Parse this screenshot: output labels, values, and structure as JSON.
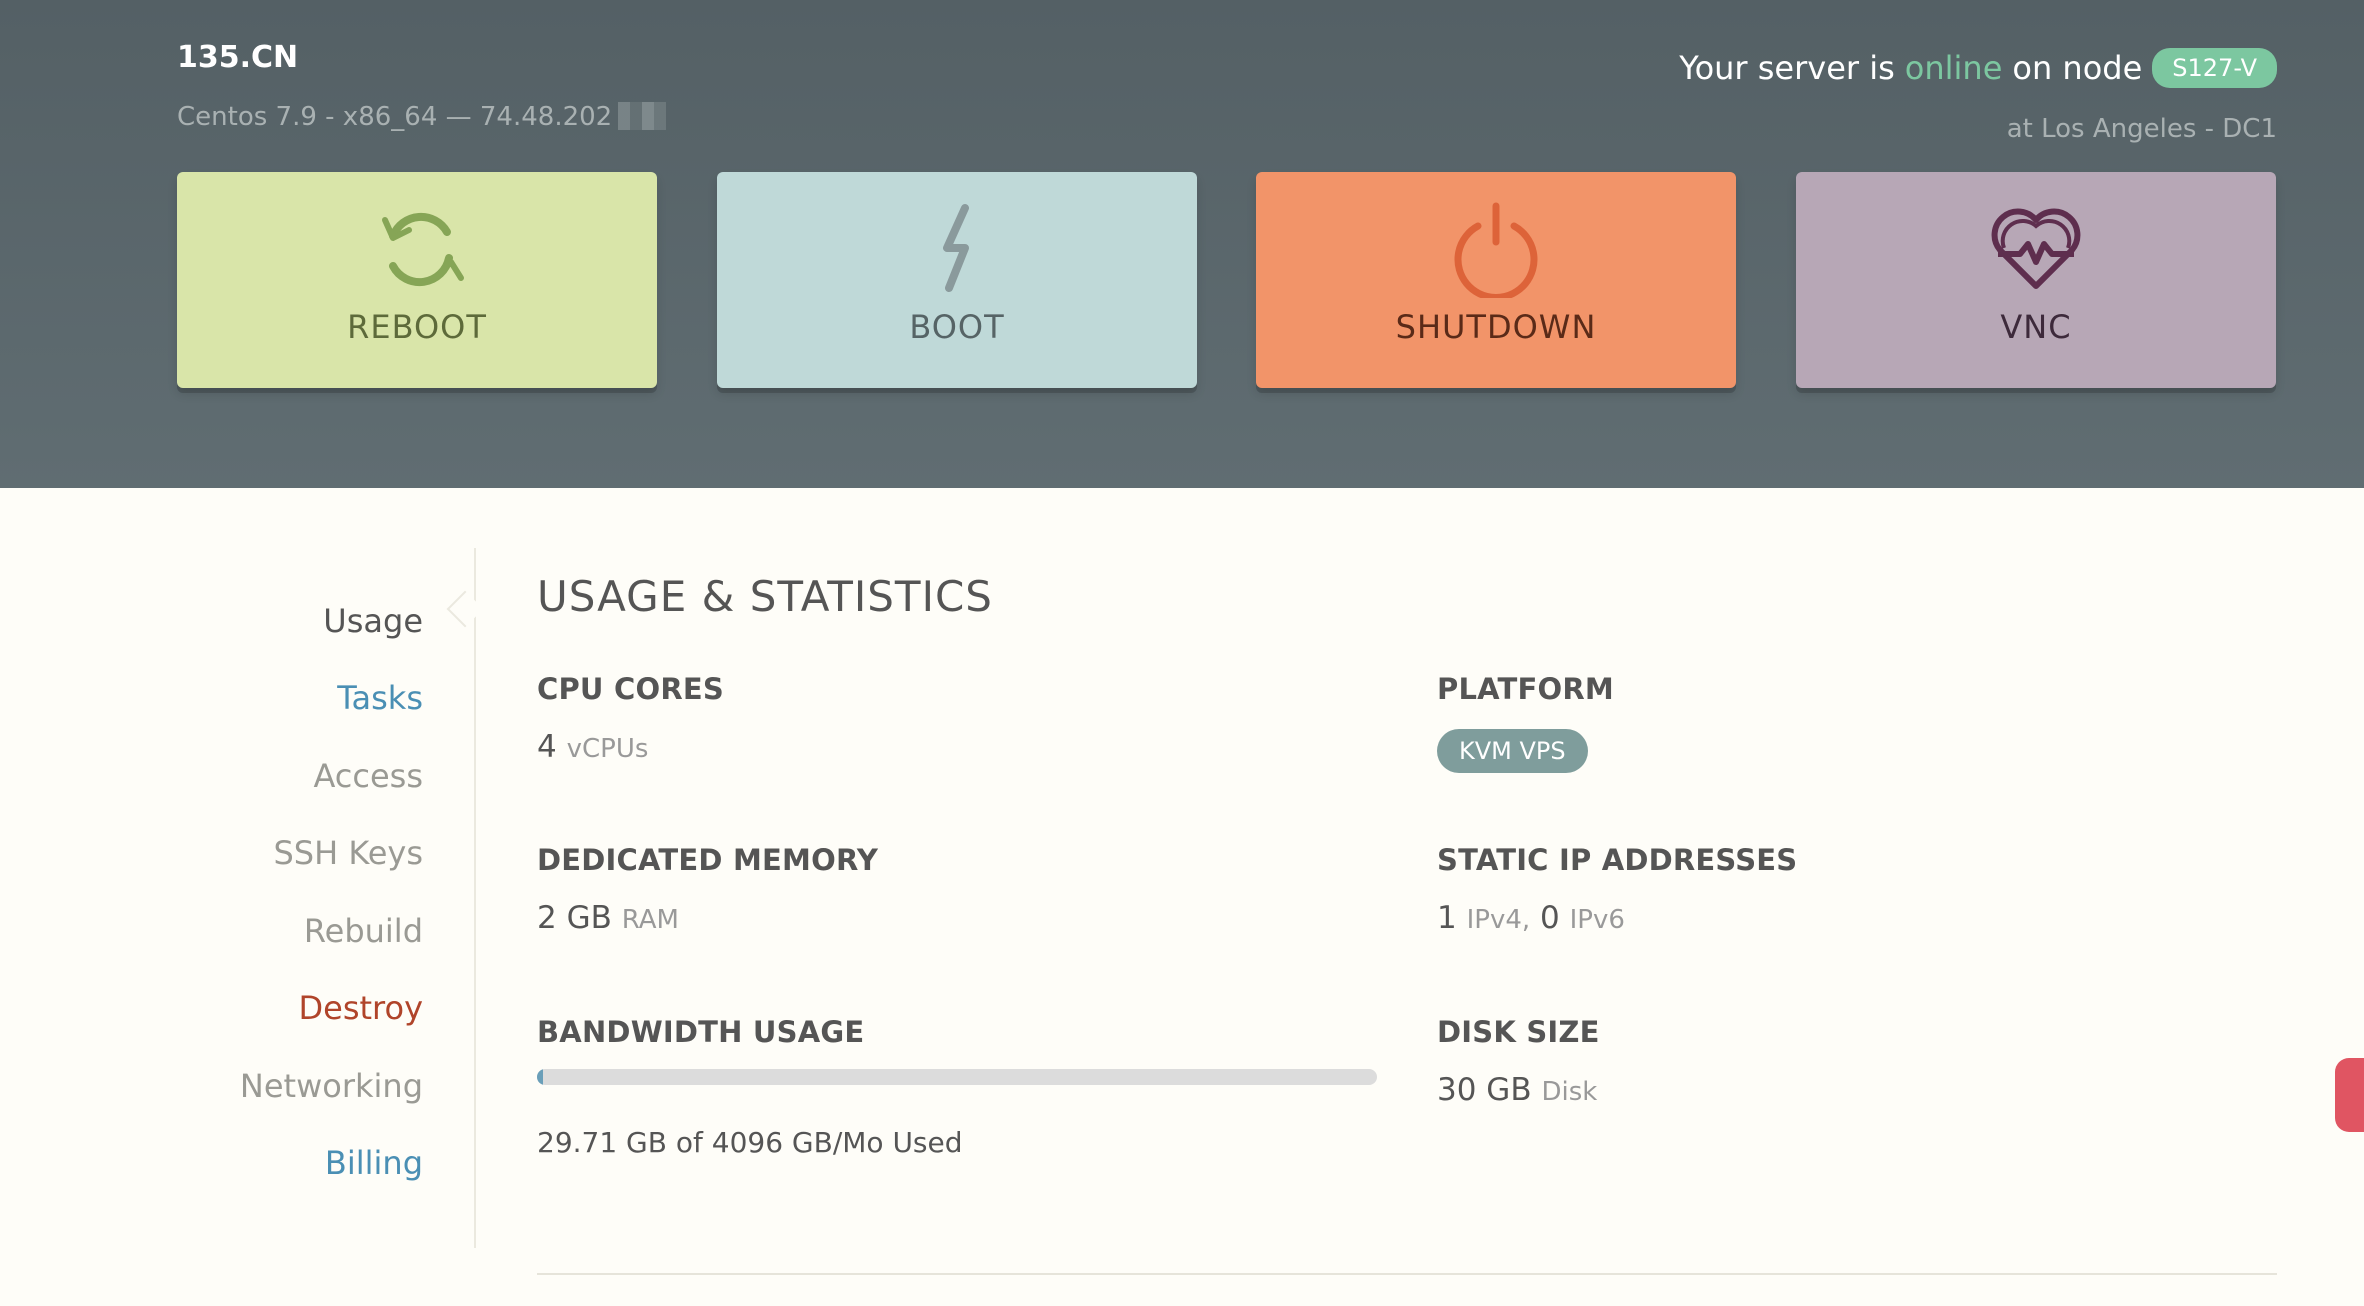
{
  "header": {
    "hostname": "135.CN",
    "os_line": "Centos 7.9 - x86_64 — 74.48.202",
    "status_prefix": "Your server is",
    "status_word": "online",
    "status_suffix": "on node",
    "node": "S127-V",
    "location": "at Los Angeles - DC1"
  },
  "actions": [
    {
      "label": "REBOOT",
      "icon": "reboot-icon"
    },
    {
      "label": "BOOT",
      "icon": "lightning-icon"
    },
    {
      "label": "SHUTDOWN",
      "icon": "power-icon"
    },
    {
      "label": "VNC",
      "icon": "heart-pulse-icon"
    }
  ],
  "sidebar": {
    "items": [
      {
        "label": "Usage"
      },
      {
        "label": "Tasks"
      },
      {
        "label": "Access"
      },
      {
        "label": "SSH Keys"
      },
      {
        "label": "Rebuild"
      },
      {
        "label": "Destroy"
      },
      {
        "label": "Networking"
      },
      {
        "label": "Billing"
      }
    ]
  },
  "main": {
    "title": "USAGE & STATISTICS",
    "cpu": {
      "label": "CPU CORES",
      "value": "4",
      "unit": "vCPUs"
    },
    "platform": {
      "label": "PLATFORM",
      "badge": "KVM VPS"
    },
    "memory": {
      "label": "DEDICATED MEMORY",
      "value": "2 GB",
      "unit": "RAM"
    },
    "ips": {
      "label": "STATIC IP ADDRESSES",
      "v4": "1",
      "v4_unit": "IPv4,",
      "v6": "0",
      "v6_unit": "IPv6"
    },
    "bandwidth": {
      "label": "BANDWIDTH USAGE",
      "used_fraction": 0.0073,
      "text": "29.71 GB of 4096 GB/Mo Used"
    },
    "disk": {
      "label": "DISK SIZE",
      "value": "30 GB",
      "unit": "Disk"
    }
  },
  "colors": {
    "online": "#7cc7a0",
    "reboot_card": "#d9e5a9",
    "boot_card": "#bfd9d8",
    "shutdown_card": "#f29469",
    "vnc_card": "#b7a7b6",
    "link": "#4a8fb4",
    "danger": "#b0442a"
  }
}
